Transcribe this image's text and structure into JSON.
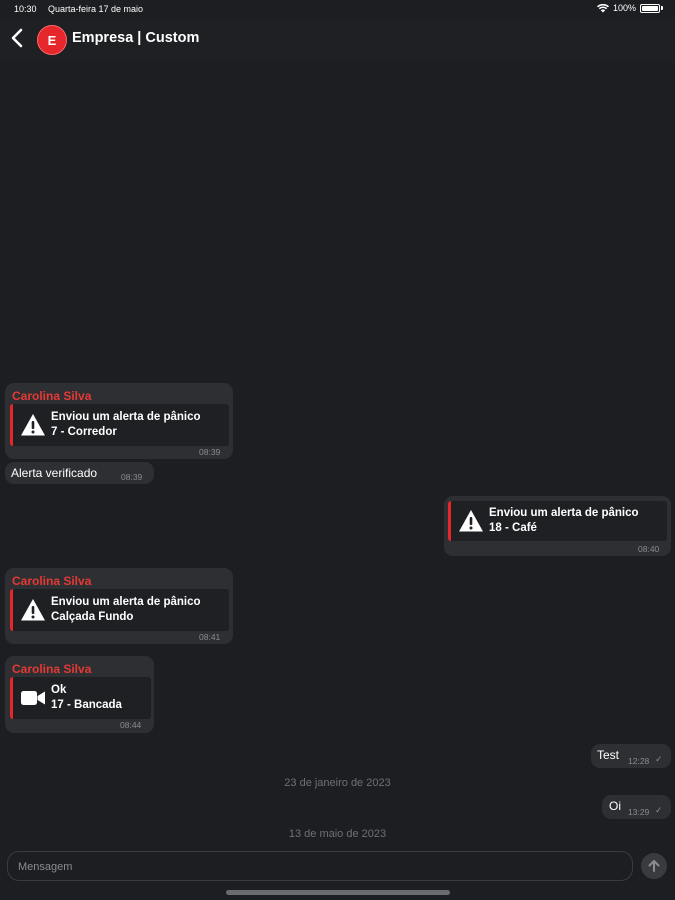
{
  "status_bar": {
    "time": "10:30",
    "date": "Quarta-feira 17 de maio",
    "battery": "100%",
    "wifi_icon": "wifi-icon",
    "battery_icon": "battery-icon"
  },
  "header": {
    "back_icon": "chevron-left-icon",
    "avatar_letter": "E",
    "title": "Empresa | Custom",
    "accent_color": "#e5262b"
  },
  "messages": [
    {
      "sender": "Carolina Silva",
      "icon": "warning-triangle-icon",
      "line1": "Enviou um alerta de pânico",
      "line2": "7 - Corredor",
      "time": "08:39"
    },
    {
      "text": "Alerta verificado",
      "time": "08:39"
    },
    {
      "icon": "warning-triangle-icon",
      "line1": "Enviou um alerta de pânico",
      "line2": "18 - Café",
      "time": "08:40"
    },
    {
      "sender": "Carolina Silva",
      "icon": "warning-triangle-icon",
      "line1": "Enviou um alerta de pânico",
      "line2": "Calçada Fundo",
      "time": "08:41"
    },
    {
      "sender": "Carolina Silva",
      "icon": "video-camera-icon",
      "line1": "Ok",
      "line2": "17 - Bancada",
      "time": "08:44"
    },
    {
      "text": "Test",
      "time": "12:28"
    },
    {
      "text": "Oi",
      "time": "13:29"
    }
  ],
  "date_separators": [
    "23 de janeiro de 2023",
    "13 de maio de 2023"
  ],
  "composer": {
    "placeholder": "Mensagem",
    "value": "",
    "send_icon": "arrow-up-icon"
  },
  "colors": {
    "background": "#1d1e21",
    "bubble": "#2e2f33",
    "sender_name": "#e53935"
  }
}
